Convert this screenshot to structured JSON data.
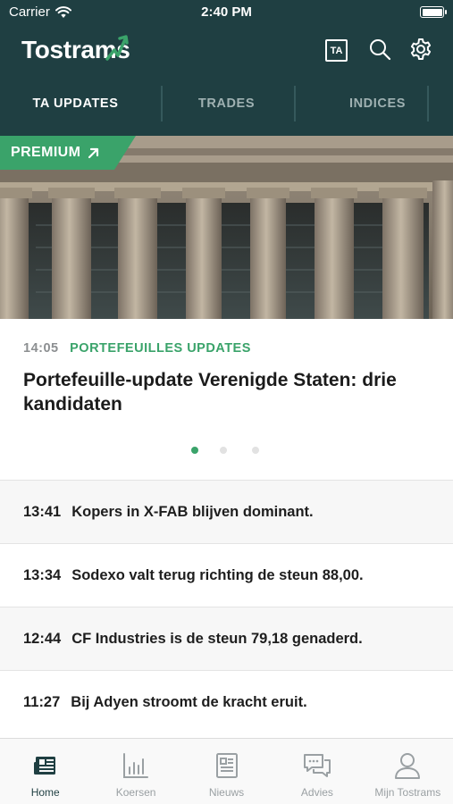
{
  "status_bar": {
    "carrier": "Carrier",
    "time": "2:40 PM"
  },
  "header": {
    "logo_text": "Tostrams",
    "ta_badge": "TA",
    "icons": [
      "ta-icon",
      "search-icon",
      "gear-icon"
    ]
  },
  "tabs": [
    {
      "label": "TA UPDATES",
      "active": true
    },
    {
      "label": "TRADES",
      "active": false
    },
    {
      "label": "INDICES",
      "active": false
    }
  ],
  "hero": {
    "premium_label": "PREMIUM"
  },
  "featured": {
    "time": "14:05",
    "category": "PORTEFEUILLES UPDATES",
    "title": "Portefeuille-update Verenigde Staten: drie kandidaten",
    "pages": 3,
    "active_page": 1
  },
  "news": [
    {
      "time": "13:41",
      "title": "Kopers in X-FAB blijven dominant."
    },
    {
      "time": "13:34",
      "title": "Sodexo valt terug richting de steun 88,00."
    },
    {
      "time": "12:44",
      "title": "CF Industries is de steun 79,18 genaderd."
    },
    {
      "time": "11:27",
      "title": "Bij Adyen stroomt de kracht eruit."
    }
  ],
  "tabbar": [
    {
      "label": "Home",
      "icon": "newspaper-icon",
      "active": true
    },
    {
      "label": "Koersen",
      "icon": "bar-chart-icon",
      "active": false
    },
    {
      "label": "Nieuws",
      "icon": "document-icon",
      "active": false
    },
    {
      "label": "Advies",
      "icon": "chat-bubbles-icon",
      "active": false
    },
    {
      "label": "Mijn Tostrams",
      "icon": "person-icon",
      "active": false
    }
  ],
  "colors": {
    "header_bg": "#1f3f42",
    "accent_green": "#3aa36a",
    "muted_tab": "#9fb1b2"
  }
}
